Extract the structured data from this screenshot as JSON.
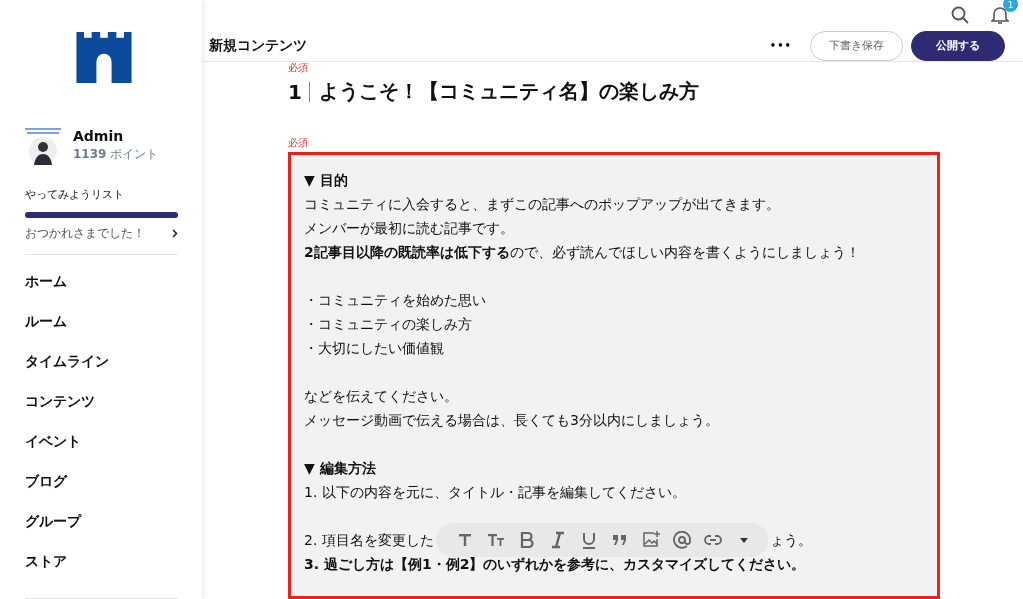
{
  "sidebar": {
    "user": {
      "name": "Admin",
      "points": "1139",
      "points_unit": "ポイント"
    },
    "todo": {
      "title": "やってみようリスト",
      "level": 1,
      "message": "おつかれさまでした！"
    },
    "items": [
      {
        "label": "ホーム"
      },
      {
        "label": "ルーム"
      },
      {
        "label": "タイムライン"
      },
      {
        "label": "コンテンツ"
      },
      {
        "label": "イベント"
      },
      {
        "label": "ブログ"
      },
      {
        "label": "グループ"
      },
      {
        "label": "ストア"
      }
    ]
  },
  "header": {
    "notification_count": "1",
    "title": "新規コンテンツ",
    "more": "•••",
    "buttons": [
      {
        "label": "下書き保存",
        "kind": "secondary"
      },
      {
        "label": "公開する",
        "kind": "primary"
      }
    ]
  },
  "editor": {
    "title_required": "必須",
    "title_number": "1",
    "title": "ようこそ！【コミュニティ名】の楽しみ方",
    "body_required": "必須",
    "paragraphs": [
      {
        "heading": "▼ 目的",
        "lines": [
          "コミュニティに入会すると、まずこの記事へのポップアップが出てきます。",
          "メンバーが最初に読む記事です。",
          "**2記事目以降の既読率は低下する**ので、必ず読んでほしい内容を書くようにしましょう！"
        ]
      },
      {
        "lines": [
          "・コミュニティを始めた思い",
          "・コミュニティの楽しみ方",
          "・大切にしたい価値観"
        ]
      },
      {
        "lines": [
          "などを伝えてください。",
          "メッセージ動画で伝える場合は、長くても3分以内にしましょう。"
        ]
      },
      {
        "heading": "▼ 編集方法",
        "lines": [
          "1. 以下の内容を元に、タイトル・記事を編集してください。"
        ]
      }
    ],
    "partial_line": {
      "start": "2. 項目名を変更した",
      "end": "ょう。"
    },
    "last_line": "3. 過ごし方は【例1・例2】のいずれかを参考に、カスタマイズしてください。"
  }
}
